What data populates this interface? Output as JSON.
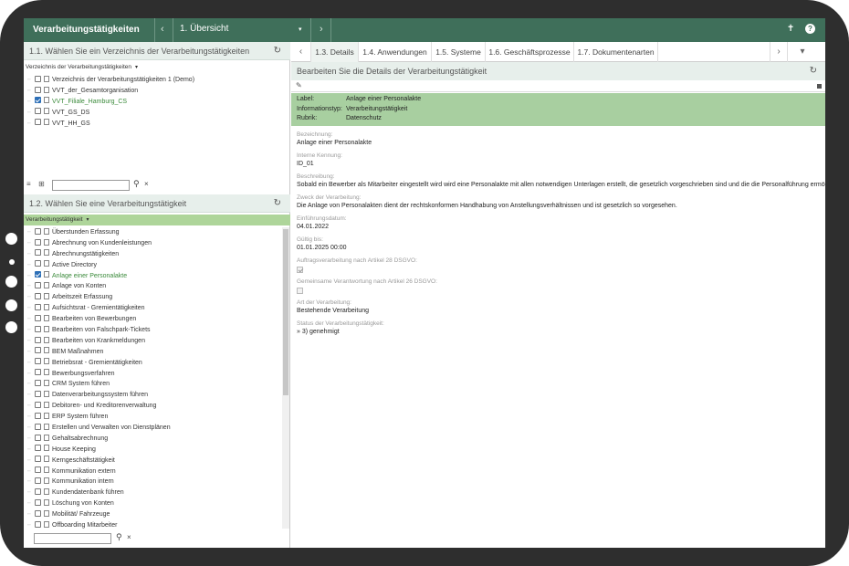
{
  "topbar": {
    "app_title": "Verarbeitungstätigkeiten",
    "crumb": "1. Übersicht",
    "prev_glyph": "‹",
    "next_glyph": "›",
    "dropdown_glyph": "▾",
    "pin_glyph": "✝",
    "help_glyph": "?"
  },
  "left": {
    "section1": {
      "title": "1.1. Wählen Sie ein Verzeichnis der Verarbeitungstätigkeiten",
      "refresh_glyph": "↻",
      "column_header": "Verzeichnis der Verarbeitungstätigkeiten",
      "sort_glyph": "▾",
      "items": [
        {
          "label": "Verzeichnis der Verarbeitungstätigkeiten 1 (Demo)",
          "checked": false,
          "selected": false
        },
        {
          "label": "VVT_der_Gesamtorganisation",
          "checked": false,
          "selected": false
        },
        {
          "label": "VVT_Filiale_Hamburg_CS",
          "checked": true,
          "selected": true
        },
        {
          "label": "VVT_GS_DS",
          "checked": false,
          "selected": false
        },
        {
          "label": "VVT_HH_GS",
          "checked": false,
          "selected": false
        }
      ]
    },
    "filter1": {
      "icon_a": "≡",
      "icon_b": "⊞",
      "search_glyph": "⚲",
      "clear_glyph": "×",
      "value": ""
    },
    "section2": {
      "title": "1.2. Wählen Sie eine Verarbeitungstätigkeit",
      "refresh_glyph": "↻",
      "column_header": "Verarbeitungstätigkeit",
      "sort_glyph": "▾",
      "items": [
        {
          "label": "Überstunden Erfassung",
          "checked": false,
          "selected": false
        },
        {
          "label": "Abrechnung von Kundenleistungen",
          "checked": false,
          "selected": false
        },
        {
          "label": "Abrechnungstätigkeiten",
          "checked": false,
          "selected": false
        },
        {
          "label": "Active Directory",
          "checked": false,
          "selected": false
        },
        {
          "label": "Anlage einer Personalakte",
          "checked": true,
          "selected": true
        },
        {
          "label": "Anlage von Konten",
          "checked": false,
          "selected": false
        },
        {
          "label": "Arbeitszeit Erfassung",
          "checked": false,
          "selected": false
        },
        {
          "label": "Aufsichtsrat - Gremientätigkeiten",
          "checked": false,
          "selected": false
        },
        {
          "label": "Bearbeiten von Bewerbungen",
          "checked": false,
          "selected": false
        },
        {
          "label": "Bearbeiten von Falschpark-Tickets",
          "checked": false,
          "selected": false
        },
        {
          "label": "Bearbeiten von Krankmeldungen",
          "checked": false,
          "selected": false
        },
        {
          "label": "BEM Maßnahmen",
          "checked": false,
          "selected": false
        },
        {
          "label": "Betriebsrat - Gremientätigkeiten",
          "checked": false,
          "selected": false
        },
        {
          "label": "Bewerbungsverfahren",
          "checked": false,
          "selected": false
        },
        {
          "label": "CRM System führen",
          "checked": false,
          "selected": false
        },
        {
          "label": "Datenverarbeitungssystem führen",
          "checked": false,
          "selected": false
        },
        {
          "label": "Debitoren- und Kreditorenverwaltung",
          "checked": false,
          "selected": false
        },
        {
          "label": "ERP System führen",
          "checked": false,
          "selected": false
        },
        {
          "label": "Erstellen und Verwalten von Dienstplänen",
          "checked": false,
          "selected": false
        },
        {
          "label": "Gehaltsabrechnung",
          "checked": false,
          "selected": false
        },
        {
          "label": "House Keeping",
          "checked": false,
          "selected": false
        },
        {
          "label": "Kerngeschäftstätigkeit",
          "checked": false,
          "selected": false
        },
        {
          "label": "Kommunikation extern",
          "checked": false,
          "selected": false
        },
        {
          "label": "Kommunikation intern",
          "checked": false,
          "selected": false
        },
        {
          "label": "Kundendatenbank führen",
          "checked": false,
          "selected": false
        },
        {
          "label": "Löschung von Konten",
          "checked": false,
          "selected": false
        },
        {
          "label": "Mobilität/ Fahrzeuge",
          "checked": false,
          "selected": false
        },
        {
          "label": "Offboarding Mitarbeiter",
          "checked": false,
          "selected": false
        }
      ]
    },
    "filter2": {
      "search_glyph": "⚲",
      "clear_glyph": "×",
      "value": ""
    }
  },
  "right": {
    "tabs": [
      {
        "label": "1.3. Details",
        "active": true
      },
      {
        "label": "1.4. Anwendungen",
        "active": false
      },
      {
        "label": "1.5. Systeme",
        "active": false
      },
      {
        "label": "1.6. Geschäftsprozesse",
        "active": false
      },
      {
        "label": "1.7. Dokumentenarten",
        "active": false
      }
    ],
    "tab_prev": "‹",
    "tab_next": "›",
    "tab_menu": "▾",
    "detail_title": "Bearbeiten Sie die Details der Verarbeitungstätigkeit",
    "refresh_glyph": "↻",
    "edit_glyph": "✎",
    "summary": [
      {
        "key": "Label:",
        "value": "Anlage einer Personalakte"
      },
      {
        "key": "Informationstyp:",
        "value": "Verarbeitungstätigkeit"
      },
      {
        "key": "Rubrik:",
        "value": "Datenschutz"
      }
    ],
    "fields": [
      {
        "label": "Bezeichnung:",
        "value": "Anlage einer Personalakte",
        "type": "text"
      },
      {
        "label": "Interne Kennung:",
        "value": "ID_01",
        "type": "text"
      },
      {
        "label": "Beschreibung:",
        "value": "Sobald ein Bewerber als Mitarbeiter eingestellt wird wird eine Personalakte mit allen notwendigen Unterlagen erstellt, die gesetzlich vorgeschrieben sind und die die Personalführung ermöglichen.",
        "type": "text"
      },
      {
        "label": "Zweck der Verarbeitung:",
        "value": "Die Anlage von Personalakten dient der rechtskonformen Handhabung von Anstellungsverhältnissen und ist gesetzlich so vorgesehen.",
        "type": "text"
      },
      {
        "label": "Einführungsdatum:",
        "value": "04.01.2022",
        "type": "text"
      },
      {
        "label": "Gültig bis:",
        "value": "01.01.2025 00:00",
        "type": "text"
      },
      {
        "label": "Auftragsverarbeitung nach Artikel 28 DSGVO:",
        "checked": true,
        "type": "checkbox"
      },
      {
        "label": "Gemeinsame Verantwortung nach Artikel 26 DSGVO:",
        "checked": false,
        "type": "checkbox"
      },
      {
        "label": "Art der Verarbeitung:",
        "value": "Bestehende Verarbeitung",
        "type": "text"
      },
      {
        "label": "Status der Verarbeitungstätigkeit:",
        "value": "» 3) genehmigt",
        "type": "text"
      }
    ]
  },
  "colors": {
    "topbar": "#3f6f5a",
    "section_header": "#e7efeb",
    "column_header_green": "#aed59a",
    "summary_band": "#a8cfa0",
    "checkbox_on": "#2d6fb7",
    "selected_text": "#3a8a3a",
    "frame": "#2e2e2e"
  }
}
